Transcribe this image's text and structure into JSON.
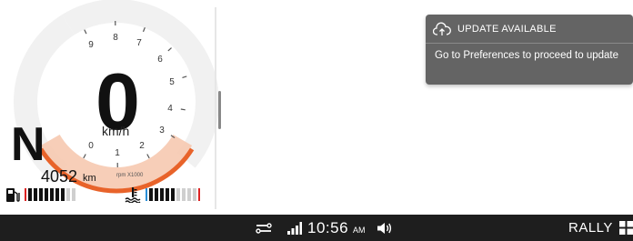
{
  "dashboard": {
    "gear": "N",
    "speed": "0",
    "speed_unit": "km/h",
    "odometer": "4052",
    "odometer_unit": "km",
    "rpm_unit": "rpm X1000",
    "rpm_ticks": [
      "0",
      "1",
      "2",
      "3",
      "4",
      "5",
      "6",
      "7",
      "8",
      "9"
    ],
    "fuel_level_segments": 7,
    "fuel_total_segments": 10,
    "temp_level_segments": 5,
    "temp_total_segments": 10,
    "colors": {
      "needle_arc": "#e8632a",
      "arc_fill": "#f6c9b0",
      "redline": "#d22",
      "cold": "#2a8fd8"
    }
  },
  "notification": {
    "title": "UPDATE AVAILABLE",
    "body": "Go to Preferences to proceed to update",
    "icon": "cloud-upload-icon"
  },
  "statusbar": {
    "time": "10:56",
    "ampm": "AM",
    "mode": "RALLY",
    "icons": [
      "connectivity-icon",
      "signal-icon",
      "volume-icon",
      "grid-menu-icon"
    ]
  }
}
